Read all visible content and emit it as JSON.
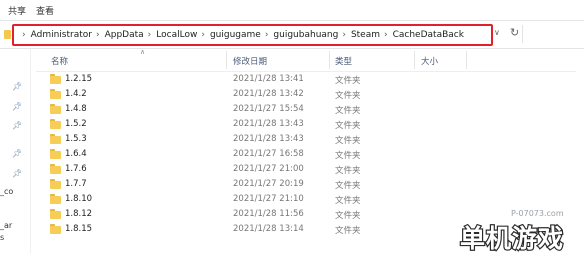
{
  "ribbon": {
    "tabs": [
      "共享",
      "查看"
    ]
  },
  "address": {
    "breadcrumbs": [
      "Administrator",
      "AppData",
      "LocalLow",
      "guigugame",
      "guigubahuang",
      "Steam",
      "CacheDataBack"
    ]
  },
  "nav": {
    "labels": [
      "_co",
      "_ar",
      "s"
    ]
  },
  "columns": {
    "name": "名称",
    "modified": "修改日期",
    "type": "类型",
    "size": "大小"
  },
  "files": [
    {
      "name": "1.2.15",
      "modified": "2021/1/28 13:41",
      "type": "文件夹"
    },
    {
      "name": "1.4.2",
      "modified": "2021/1/28 13:42",
      "type": "文件夹"
    },
    {
      "name": "1.4.8",
      "modified": "2021/1/27 15:54",
      "type": "文件夹"
    },
    {
      "name": "1.5.2",
      "modified": "2021/1/28 13:43",
      "type": "文件夹"
    },
    {
      "name": "1.5.3",
      "modified": "2021/1/28 13:43",
      "type": "文件夹"
    },
    {
      "name": "1.6.4",
      "modified": "2021/1/27 16:58",
      "type": "文件夹"
    },
    {
      "name": "1.7.6",
      "modified": "2021/1/27 21:00",
      "type": "文件夹"
    },
    {
      "name": "1.7.7",
      "modified": "2021/1/27 20:19",
      "type": "文件夹"
    },
    {
      "name": "1.8.10",
      "modified": "2021/1/27 21:10",
      "type": "文件夹"
    },
    {
      "name": "1.8.12",
      "modified": "2021/1/28 11:56",
      "type": "文件夹"
    },
    {
      "name": "1.8.15",
      "modified": "2021/1/28 13:14",
      "type": "文件夹"
    }
  ],
  "watermark": {
    "url": "P-07073.com",
    "logo_text": "单机游戏"
  },
  "colors": {
    "highlight_border": "#e0202a",
    "folder": "#f6cd57",
    "watermark": "#2a2a2a"
  }
}
